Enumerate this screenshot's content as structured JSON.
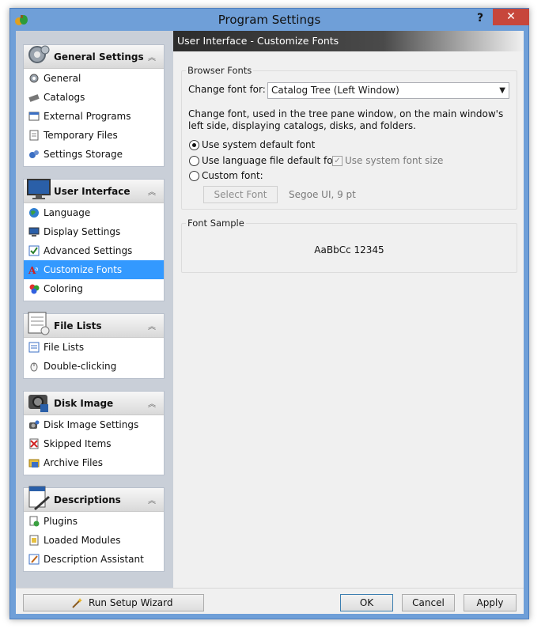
{
  "window": {
    "title": "Program Settings",
    "help": "?",
    "close": "✕"
  },
  "sidebar": {
    "groups": [
      {
        "title": "General Settings",
        "icon": "gears-icon",
        "items": [
          {
            "label": "General",
            "icon": "gear-icon"
          },
          {
            "label": "Catalogs",
            "icon": "catalog-icon"
          },
          {
            "label": "External Programs",
            "icon": "external-programs-icon"
          },
          {
            "label": "Temporary Files",
            "icon": "temp-files-icon"
          },
          {
            "label": "Settings Storage",
            "icon": "settings-storage-icon"
          }
        ]
      },
      {
        "title": "User Interface",
        "icon": "monitor-icon",
        "items": [
          {
            "label": "Language",
            "icon": "globe-icon"
          },
          {
            "label": "Display Settings",
            "icon": "display-icon"
          },
          {
            "label": "Advanced Settings",
            "icon": "advanced-settings-icon"
          },
          {
            "label": "Customize Fonts",
            "icon": "fonts-icon",
            "selected": true
          },
          {
            "label": "Coloring",
            "icon": "palette-icon"
          }
        ]
      },
      {
        "title": "File Lists",
        "icon": "file-list-icon",
        "items": [
          {
            "label": "File Lists",
            "icon": "list-icon"
          },
          {
            "label": "Double-clicking",
            "icon": "mouse-icon"
          }
        ]
      },
      {
        "title": "Disk Image",
        "icon": "camera-icon",
        "items": [
          {
            "label": "Disk Image Settings",
            "icon": "disk-image-icon"
          },
          {
            "label": "Skipped Items",
            "icon": "skipped-icon"
          },
          {
            "label": "Archive Files",
            "icon": "archive-icon"
          }
        ]
      },
      {
        "title": "Descriptions",
        "icon": "descriptions-icon",
        "items": [
          {
            "label": "Plugins",
            "icon": "plugin-icon"
          },
          {
            "label": "Loaded Modules",
            "icon": "module-icon"
          },
          {
            "label": "Description Assistant",
            "icon": "assistant-icon"
          }
        ]
      }
    ],
    "collapse_glyph": "︽"
  },
  "main": {
    "header": "User Interface - Customize Fonts",
    "browser_fonts": {
      "legend": "Browser Fonts",
      "change_font_label": "Change font for:",
      "change_font_value": "Catalog Tree (Left Window)",
      "description": "Change font, used in the tree pane window, on the main window's left side, displaying catalogs, disks, and folders.",
      "opt_system": "Use system default font",
      "opt_language": "Use language file default font",
      "opt_system_size": "Use system font size",
      "opt_custom": "Custom font:",
      "select_font_btn": "Select Font",
      "font_value": "Segoe UI, 9 pt"
    },
    "font_sample": {
      "legend": "Font Sample",
      "text": "AaBbCc 12345"
    }
  },
  "footer": {
    "wizard": "Run Setup Wizard",
    "ok": "OK",
    "cancel": "Cancel",
    "apply": "Apply"
  },
  "colors": {
    "selection": "#3399ff",
    "titlebar": "#6f9fd8",
    "close": "#c7463b"
  }
}
